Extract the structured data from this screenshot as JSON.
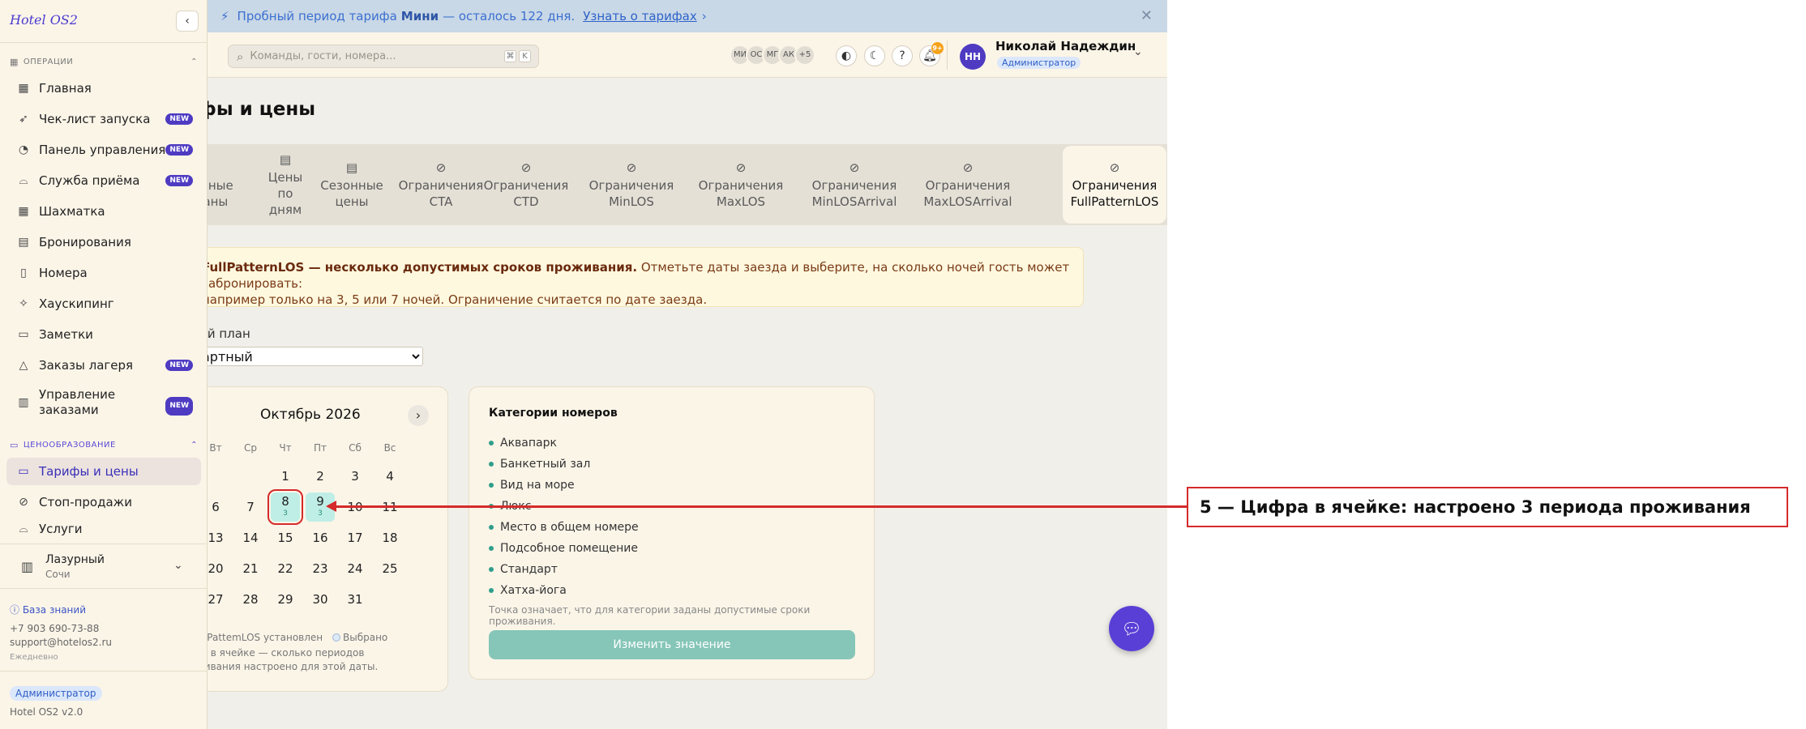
{
  "banner": {
    "text_before": "Пробный период тарифа",
    "plan": "Мини",
    "text_after": "— осталось 122 дня.",
    "link": "Узнать о тарифах"
  },
  "search": {
    "placeholder": "Команды, гости, номера...",
    "kbd1": "⌘",
    "kbd2": "K"
  },
  "presence": [
    "МИ",
    "ОС",
    "МГ",
    "АК",
    "+5"
  ],
  "notifications": {
    "badge": "9+"
  },
  "user": {
    "initials": "НН",
    "name": "Николай Надеждин",
    "role": "Администратор"
  },
  "page": {
    "title": "фы и цены"
  },
  "tabs": [
    {
      "icon": "chevron-right-icon",
      "label": "фные\nаны"
    },
    {
      "icon": "calendar-icon",
      "label": "Цены\nпо\nдням"
    },
    {
      "icon": "calendar-icon",
      "label": "Сезонные\nцены"
    },
    {
      "icon": "ban-icon",
      "label": "Ограничения\nCTA"
    },
    {
      "icon": "ban-icon",
      "label": "Ограничения\nCTD"
    },
    {
      "icon": "ban-icon",
      "label": "Ограничения\nMinLOS"
    },
    {
      "icon": "ban-icon",
      "label": "Ограничения\nMaxLOS"
    },
    {
      "icon": "ban-icon",
      "label": "Ограничения\nMinLOSArrival"
    },
    {
      "icon": "ban-icon",
      "label": "Ограничения\nMaxLOSArrival"
    },
    {
      "icon": "ban-icon",
      "label": "Ограничения\nFullPatternLOS",
      "active": true
    }
  ],
  "info": {
    "bold": "FullPatternLOS — несколько допустимых сроков проживания.",
    "text1": " Отметьте даты заезда и выберите, на сколько ночей гость может забронировать:",
    "text2": "например только на 3, 5 или 7 ночей. Ограничение считается по дате заезда."
  },
  "plan": {
    "label": "ый план",
    "selected": "артный"
  },
  "calendar": {
    "month": "Октябрь 2026",
    "weekdays": [
      "Вт",
      "Ср",
      "Чт",
      "Пт",
      "Сб",
      "Вс"
    ],
    "rows": [
      [
        "",
        "",
        "1",
        "2",
        "3",
        "4"
      ],
      [
        "6",
        "7",
        "8",
        "9",
        "10",
        "11"
      ],
      [
        "13",
        "14",
        "15",
        "16",
        "17",
        "18"
      ],
      [
        "20",
        "21",
        "22",
        "23",
        "24",
        "25"
      ],
      [
        "27",
        "28",
        "29",
        "30",
        "31",
        ""
      ]
    ],
    "set_days": {
      "8": "3",
      "9": "3"
    },
    "selected_day": "8",
    "legend_set": "ullPattemLOS установлен",
    "legend_selected": "Выбрано",
    "legend_note": "ра в ячейке — сколько периодов\nживания настроено для этой даты."
  },
  "categories": {
    "title": "Категории номеров",
    "items": [
      "Аквапарк",
      "Банкетный зал",
      "Вид на море",
      "Люкс",
      "Место в общем номере",
      "Подсобное помещение",
      "Стандарт",
      "Хатха-йога"
    ],
    "note": "Точка означает, что для категории заданы допустимые сроки проживания.",
    "button": "Изменить значение"
  },
  "sidebar": {
    "logo": "Hotel OS2",
    "section_ops": "ОПЕРАЦИИ",
    "section_pricing": "ЦЕНООБРАЗОВАНИЕ",
    "items": [
      {
        "icon": "grid-icon",
        "label": "Главная"
      },
      {
        "icon": "rocket-icon",
        "label": "Чек-лист запуска",
        "badge": "NEW"
      },
      {
        "icon": "gauge-icon",
        "label": "Панель управления",
        "badge": "NEW"
      },
      {
        "icon": "bell-service-icon",
        "label": "Служба приёма",
        "badge": "NEW"
      },
      {
        "icon": "table-icon",
        "label": "Шахматка"
      },
      {
        "icon": "clipboard-icon",
        "label": "Бронирования"
      },
      {
        "icon": "door-icon",
        "label": "Номера"
      },
      {
        "icon": "sparkle-icon",
        "label": "Хаускипинг"
      },
      {
        "icon": "note-icon",
        "label": "Заметки"
      },
      {
        "icon": "tent-icon",
        "label": "Заказы лагеря",
        "badge": "NEW"
      },
      {
        "icon": "receipt-icon",
        "label": "Управление\nзаказами",
        "badge": "NEW"
      }
    ],
    "pricing_items": [
      {
        "icon": "card-icon",
        "label": "Тарифы и цены",
        "active": true
      },
      {
        "icon": "ban-icon",
        "label": "Стоп-продажи"
      },
      {
        "icon": "concierge-icon",
        "label": "Услуги"
      }
    ],
    "hotel": {
      "name": "Лазурный",
      "city": "Сочи"
    },
    "kb": "База знаний",
    "phone": "+7 903 690-73-88",
    "email": "support@hotelos2.ru",
    "daily": "Ежедневно",
    "role": "Администратор",
    "version": "Hotel OS2 v2.0"
  },
  "annotation": {
    "text": "5 — Цифра в ячейке: настроено 3 периода проживания"
  },
  "colors": {
    "accent": "#4e3bc2",
    "teal": "#85c6b8",
    "annotation": "#d52a2a"
  }
}
